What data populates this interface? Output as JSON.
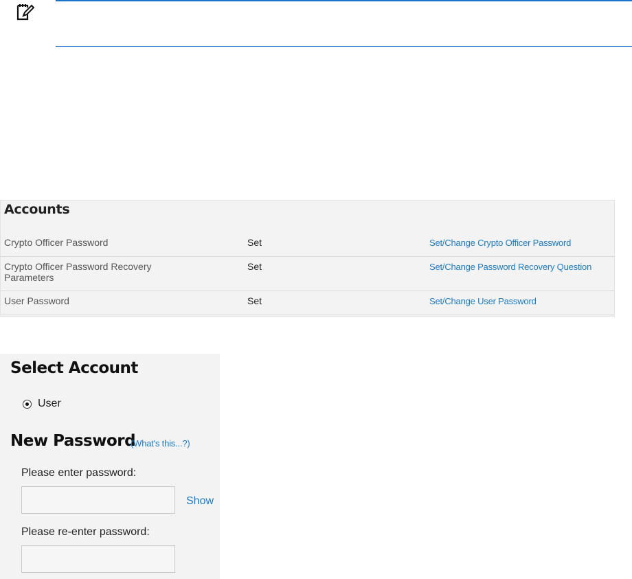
{
  "note": {
    "icon": "note-edit-icon"
  },
  "accounts": {
    "title": "Accounts",
    "rows": [
      {
        "label": "Crypto Officer Password",
        "status": "Set",
        "action": "Set/Change Crypto Officer Password"
      },
      {
        "label": "Crypto Officer Password Recovery Parameters",
        "status": "Set",
        "action": "Set/Change Password Recovery Question"
      },
      {
        "label": "User Password",
        "status": "Set",
        "action": "Set/Change User Password"
      }
    ]
  },
  "select_account": {
    "title": "Select Account",
    "option": "User",
    "option_selected": true
  },
  "new_password": {
    "title": "New Password",
    "help_link": "(What's this...?)",
    "enter_label": "Please enter password:",
    "enter_value": "",
    "show_link": "Show",
    "reenter_label": "Please re-enter password:",
    "reenter_value": ""
  },
  "colors": {
    "link": "#1b7bc4",
    "rule": "#1a73c9",
    "panel": "#f3f3f3"
  }
}
